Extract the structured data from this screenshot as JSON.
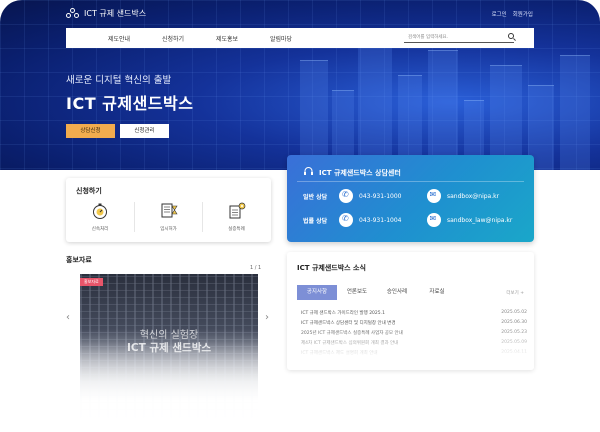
{
  "header": {
    "logo_text": "ICT 규제 샌드박스",
    "login": "로그인",
    "signup": "회원가입",
    "nav": [
      "제도안내",
      "신청하기",
      "제도홍보",
      "알림마당"
    ],
    "search_placeholder": "검색어를 입력하세요."
  },
  "hero": {
    "subtitle": "새로운 디지털 혁신의 출발",
    "title": "ICT 규제샌드박스",
    "btn_primary": "상담신청",
    "btn_secondary": "신청관리"
  },
  "apply": {
    "title": "신청하기",
    "items": [
      {
        "label": "신속처리",
        "icon": "stopwatch-icon"
      },
      {
        "label": "임시허가",
        "icon": "document-hourglass-icon"
      },
      {
        "label": "실증특례",
        "icon": "document-gear-icon"
      }
    ]
  },
  "promo": {
    "title": "홍보자료",
    "pager": "1 / 1",
    "tag": "홍보자료",
    "line1": "혁신의 실험장",
    "line2": "ICT 규제 샌드박스"
  },
  "consult": {
    "title": "ICT 규제샌드박스 상담센터",
    "rows": [
      {
        "key": "일반 상담",
        "phone": "043-931-1000",
        "email": "sandbox@nipa.kr"
      },
      {
        "key": "법률 상담",
        "phone": "043-931-1004",
        "email": "sandbox_law@nipa.kr"
      }
    ]
  },
  "news": {
    "title": "ICT 규제샌드박스 소식",
    "tabs": [
      "공지사항",
      "언론보도",
      "승인사례",
      "자료실"
    ],
    "more": "더보기 +",
    "items": [
      {
        "title": "ICT 규제 샌드박스 가이드라인 발행 2025.1",
        "date": "2025.05.02"
      },
      {
        "title": "ICT 규제샌드박스 상담센터 및 디지털창 안내 변경",
        "date": "2025.06.30"
      },
      {
        "title": "2025년 ICT 규제샌드박스 실증특례 사업자 공모 안내",
        "date": "2025.05.23"
      },
      {
        "title": "제4차 ICT 규제샌드박스 심의위원회 개최 결과 안내",
        "date": "2025.05.09"
      },
      {
        "title": "ICT 규제샌드박스 제도 설명회 개최 안내",
        "date": "2025.04.11"
      }
    ]
  },
  "colors": {
    "hero_bg": "#0a1f6e",
    "accent_orange": "#f2ac4e",
    "consult_bg": "#1f8fd0",
    "tab_active": "#7d8fd6",
    "promo_tag": "#e8556a"
  }
}
